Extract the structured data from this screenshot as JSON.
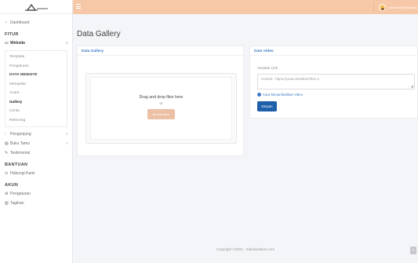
{
  "sidebar": {
    "dashboard": "Dashboard",
    "fitur_title": "FITUR",
    "website": "Website",
    "website_sub": [
      "Template",
      "Pengaturan",
      "DATA WEBSITE",
      "Mempelai",
      "Acara",
      "Gallery",
      "Cerita",
      "Rekening"
    ],
    "pengunjung": "Pengunjung",
    "buku_tamu": "Buku Tamu",
    "testimonial": "Testimonial",
    "bantuan_title": "BANTUAN",
    "hubungi": "Hubungi Kami",
    "akun_title": "AKUN",
    "pengaturan": "Pengaturan",
    "tagihan": "Tagihan"
  },
  "topbar": {
    "user_name": "rosesweet11@gmail.com"
  },
  "main": {
    "page_title": "Data Gallery",
    "gallery_card_title": "Data Gallery",
    "dropzone_title": "Drag and drop files here",
    "dropzone_or": "or",
    "browse_button": "Browse files",
    "video_card_title": "Data Video",
    "youtube_label": "Youtube Link",
    "youtube_placeholder": "Contoh : https://youtu.be/dKkz/hhru s",
    "howto_link": "Cara Menambahkan Video",
    "save_button": "Simpan"
  },
  "footer": {
    "copyright": "Copyright ©2024 - Sidoinvitation.com"
  }
}
